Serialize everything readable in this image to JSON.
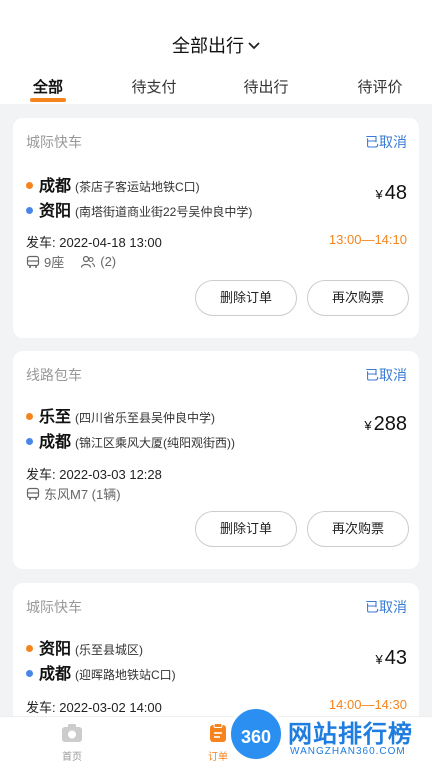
{
  "header": {
    "title": "全部出行",
    "tabs": [
      "全部",
      "待支付",
      "待出行",
      "待评价"
    ]
  },
  "orders": [
    {
      "type": "城际快车",
      "status": "已取消",
      "from_city": "成都",
      "from_addr": "(茶店子客运站地铁C口)",
      "to_city": "资阳",
      "to_addr": "(南塔街道商业街22号吴仲良中学)",
      "price_symbol": "¥",
      "price": "48",
      "depart": "发车: 2022-04-18 13:00",
      "time_range": "13:00—14:10",
      "seats": "9座",
      "passengers": "(2)",
      "btn_delete": "删除订单",
      "btn_rebuy": "再次购票"
    },
    {
      "type": "线路包车",
      "status": "已取消",
      "from_city": "乐至",
      "from_addr": "(四川省乐至县吴仲良中学)",
      "to_city": "成都",
      "to_addr": "(锦江区乘风大厦(纯阳观街西))",
      "price_symbol": "¥",
      "price": "288",
      "depart": "发车: 2022-03-03 12:28",
      "vehicle": "东风M7 (1辆)",
      "btn_delete": "删除订单",
      "btn_rebuy": "再次购票"
    },
    {
      "type": "城际快车",
      "status": "已取消",
      "from_city": "资阳",
      "from_addr": "(乐至县城区)",
      "to_city": "成都",
      "to_addr": "(迎晖路地铁站C口)",
      "price_symbol": "¥",
      "price": "43",
      "depart": "发车: 2022-03-02 14:00",
      "time_range": "14:00—14:30"
    }
  ],
  "tabbar": {
    "home": "首页",
    "orders": "订单"
  },
  "watermark": {
    "badge": "360",
    "text": "网站排行榜",
    "sub": "WANGZHAN360.COM"
  },
  "colors": {
    "accent": "#f5841f",
    "status_blue": "#3a7bd5",
    "background": "#f2f3f5"
  }
}
